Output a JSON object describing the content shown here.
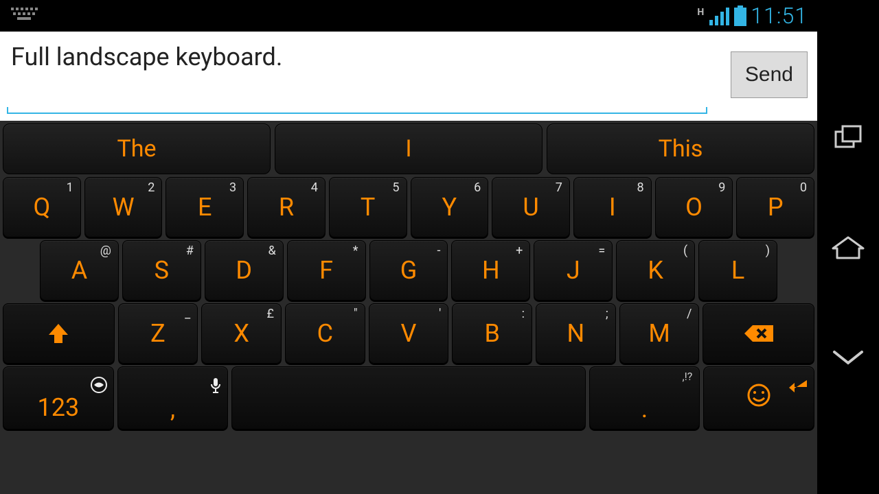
{
  "status": {
    "network_type": "H",
    "time": "11:51"
  },
  "input": {
    "text": "Full landscape keyboard.",
    "send_label": "Send"
  },
  "suggestions": [
    "The",
    "I",
    "This"
  ],
  "keyboard": {
    "row1": [
      {
        "main": "Q",
        "sec": "1"
      },
      {
        "main": "W",
        "sec": "2"
      },
      {
        "main": "E",
        "sec": "3"
      },
      {
        "main": "R",
        "sec": "4"
      },
      {
        "main": "T",
        "sec": "5"
      },
      {
        "main": "Y",
        "sec": "6"
      },
      {
        "main": "U",
        "sec": "7"
      },
      {
        "main": "I",
        "sec": "8"
      },
      {
        "main": "O",
        "sec": "9"
      },
      {
        "main": "P",
        "sec": "0"
      }
    ],
    "row2": [
      {
        "main": "A",
        "sec": "@"
      },
      {
        "main": "S",
        "sec": "#"
      },
      {
        "main": "D",
        "sec": "&"
      },
      {
        "main": "F",
        "sec": "*"
      },
      {
        "main": "G",
        "sec": "-"
      },
      {
        "main": "H",
        "sec": "+"
      },
      {
        "main": "J",
        "sec": "="
      },
      {
        "main": "K",
        "sec": "("
      },
      {
        "main": "L",
        "sec": ")"
      }
    ],
    "row3": [
      {
        "main": "Z",
        "sec": "_"
      },
      {
        "main": "X",
        "sec": "£"
      },
      {
        "main": "C",
        "sec": "\""
      },
      {
        "main": "V",
        "sec": "'"
      },
      {
        "main": "B",
        "sec": ":"
      },
      {
        "main": "N",
        "sec": ";"
      },
      {
        "main": "M",
        "sec": "/"
      }
    ],
    "row4": {
      "numeric_label": "123",
      "comma": ",",
      "period": ".",
      "period_sec": ",!?"
    }
  }
}
